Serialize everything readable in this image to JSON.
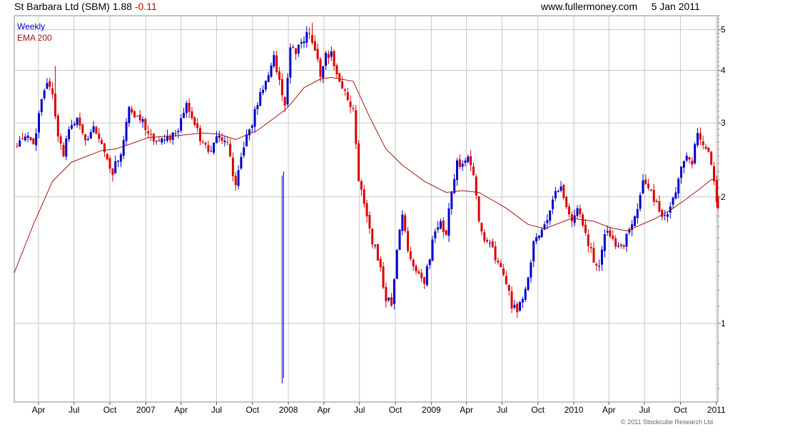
{
  "header": {
    "title": "St Barbara Ltd (SBM) 1.88",
    "change": "-0.11",
    "site": "www.fullermoney.com",
    "date": "5 Jan 2011"
  },
  "legend": {
    "weekly": "Weekly",
    "ema": "EMA 200"
  },
  "copyright": "© 2011 Stockcube Research Ltd",
  "colors": {
    "up": "#0000cc",
    "down": "#dd0000",
    "ema": "#aa1111",
    "grid": "#c8c8c8"
  },
  "chart_data": {
    "type": "candlestick",
    "scale": "log",
    "ylim": [
      0.65,
      5.4
    ],
    "y_ticks": [
      1,
      2,
      3,
      4,
      5
    ],
    "x_range": [
      "2006-01-29",
      "2011-01-05"
    ],
    "x_ticks": [
      {
        "date": "2006-04-01",
        "label": "Apr"
      },
      {
        "date": "2006-07-01",
        "label": "Jul"
      },
      {
        "date": "2006-10-01",
        "label": "Oct"
      },
      {
        "date": "2007-01-01",
        "label": "2007"
      },
      {
        "date": "2007-04-01",
        "label": "Apr"
      },
      {
        "date": "2007-07-01",
        "label": "Jul"
      },
      {
        "date": "2007-10-01",
        "label": "Oct"
      },
      {
        "date": "2008-01-01",
        "label": "2008"
      },
      {
        "date": "2008-04-01",
        "label": "Apr"
      },
      {
        "date": "2008-07-01",
        "label": "Jul"
      },
      {
        "date": "2008-10-01",
        "label": "Oct"
      },
      {
        "date": "2009-01-01",
        "label": "2009"
      },
      {
        "date": "2009-04-01",
        "label": "Apr"
      },
      {
        "date": "2009-07-01",
        "label": "Jul"
      },
      {
        "date": "2009-10-01",
        "label": "Oct"
      },
      {
        "date": "2010-01-01",
        "label": "2010"
      },
      {
        "date": "2010-04-01",
        "label": "Apr"
      },
      {
        "date": "2010-07-01",
        "label": "Jul"
      },
      {
        "date": "2010-10-01",
        "label": "Oct"
      },
      {
        "date": "2011-01-01",
        "label": "2011"
      }
    ],
    "close_path": [
      [
        "2006-02-05",
        2.62
      ],
      [
        "2006-02-26",
        2.78
      ],
      [
        "2006-03-19",
        2.66
      ],
      [
        "2006-04-09",
        3.45
      ],
      [
        "2006-04-23",
        3.65
      ],
      [
        "2006-05-07",
        3.55
      ],
      [
        "2006-05-21",
        2.85
      ],
      [
        "2006-06-04",
        2.55
      ],
      [
        "2006-06-18",
        2.95
      ],
      [
        "2006-07-09",
        3.02
      ],
      [
        "2006-07-30",
        2.7
      ],
      [
        "2006-08-20",
        2.9
      ],
      [
        "2006-09-10",
        2.65
      ],
      [
        "2006-09-24",
        2.45
      ],
      [
        "2006-10-08",
        2.3
      ],
      [
        "2006-10-29",
        2.55
      ],
      [
        "2006-11-19",
        3.25
      ],
      [
        "2006-12-10",
        3.1
      ],
      [
        "2006-12-31",
        2.95
      ],
      [
        "2007-01-21",
        2.65
      ],
      [
        "2007-02-11",
        2.7
      ],
      [
        "2007-03-04",
        2.75
      ],
      [
        "2007-03-25",
        2.9
      ],
      [
        "2007-04-15",
        3.3
      ],
      [
        "2007-05-06",
        2.95
      ],
      [
        "2007-05-27",
        2.65
      ],
      [
        "2007-06-17",
        2.6
      ],
      [
        "2007-07-08",
        2.85
      ],
      [
        "2007-07-29",
        2.65
      ],
      [
        "2007-08-19",
        2.1
      ],
      [
        "2007-09-02",
        2.55
      ],
      [
        "2007-09-23",
        2.9
      ],
      [
        "2007-10-14",
        3.3
      ],
      [
        "2007-11-04",
        3.85
      ],
      [
        "2007-11-25",
        4.25
      ],
      [
        "2007-12-09",
        3.8
      ],
      [
        "2007-12-23",
        3.3
      ],
      [
        "2008-01-06",
        4.6
      ],
      [
        "2008-01-20",
        4.4
      ],
      [
        "2008-02-10",
        4.75
      ],
      [
        "2008-02-24",
        4.95
      ],
      [
        "2008-03-09",
        4.55
      ],
      [
        "2008-03-23",
        3.95
      ],
      [
        "2008-04-06",
        4.3
      ],
      [
        "2008-04-20",
        4.35
      ],
      [
        "2008-05-04",
        3.9
      ],
      [
        "2008-05-18",
        3.55
      ],
      [
        "2008-06-01",
        3.45
      ],
      [
        "2008-06-15",
        3.2
      ],
      [
        "2008-06-29",
        2.2
      ],
      [
        "2008-07-13",
        1.95
      ],
      [
        "2008-07-27",
        1.65
      ],
      [
        "2008-08-10",
        1.5
      ],
      [
        "2008-08-24",
        1.35
      ],
      [
        "2008-09-07",
        1.15
      ],
      [
        "2008-09-21",
        1.1
      ],
      [
        "2008-10-05",
        1.5
      ],
      [
        "2008-10-19",
        1.8
      ],
      [
        "2008-11-02",
        1.5
      ],
      [
        "2008-11-16",
        1.35
      ],
      [
        "2008-11-30",
        1.3
      ],
      [
        "2008-12-14",
        1.25
      ],
      [
        "2008-12-28",
        1.45
      ],
      [
        "2009-01-11",
        1.65
      ],
      [
        "2009-01-25",
        1.72
      ],
      [
        "2009-02-08",
        1.65
      ],
      [
        "2009-02-22",
        2.1
      ],
      [
        "2009-03-08",
        2.4
      ],
      [
        "2009-03-22",
        2.4
      ],
      [
        "2009-04-05",
        2.5
      ],
      [
        "2009-04-19",
        2.3
      ],
      [
        "2009-05-03",
        1.75
      ],
      [
        "2009-05-17",
        1.6
      ],
      [
        "2009-05-31",
        1.55
      ],
      [
        "2009-06-14",
        1.45
      ],
      [
        "2009-06-28",
        1.35
      ],
      [
        "2009-07-12",
        1.25
      ],
      [
        "2009-07-26",
        1.1
      ],
      [
        "2009-08-09",
        1.08
      ],
      [
        "2009-08-23",
        1.15
      ],
      [
        "2009-09-06",
        1.3
      ],
      [
        "2009-09-20",
        1.55
      ],
      [
        "2009-10-04",
        1.65
      ],
      [
        "2009-10-18",
        1.75
      ],
      [
        "2009-11-01",
        1.85
      ],
      [
        "2009-11-15",
        2.05
      ],
      [
        "2009-11-29",
        2.1
      ],
      [
        "2009-12-13",
        1.85
      ],
      [
        "2009-12-27",
        1.75
      ],
      [
        "2010-01-10",
        1.85
      ],
      [
        "2010-01-24",
        1.75
      ],
      [
        "2010-02-07",
        1.55
      ],
      [
        "2010-02-21",
        1.4
      ],
      [
        "2010-03-07",
        1.35
      ],
      [
        "2010-03-21",
        1.65
      ],
      [
        "2010-04-04",
        1.6
      ],
      [
        "2010-04-18",
        1.55
      ],
      [
        "2010-05-02",
        1.5
      ],
      [
        "2010-05-16",
        1.6
      ],
      [
        "2010-05-30",
        1.7
      ],
      [
        "2010-06-13",
        1.85
      ],
      [
        "2010-06-27",
        2.2
      ],
      [
        "2010-07-11",
        2.15
      ],
      [
        "2010-07-25",
        1.95
      ],
      [
        "2010-08-08",
        1.85
      ],
      [
        "2010-08-22",
        1.8
      ],
      [
        "2010-09-05",
        1.9
      ],
      [
        "2010-09-19",
        2.05
      ],
      [
        "2010-10-03",
        2.4
      ],
      [
        "2010-10-17",
        2.55
      ],
      [
        "2010-10-31",
        2.45
      ],
      [
        "2010-11-14",
        2.9
      ],
      [
        "2010-11-28",
        2.7
      ],
      [
        "2010-12-12",
        2.55
      ],
      [
        "2010-12-26",
        2.2
      ],
      [
        "2011-01-05",
        1.88
      ]
    ],
    "ema_path": [
      [
        "2006-01-29",
        1.32
      ],
      [
        "2006-03-19",
        1.72
      ],
      [
        "2006-05-07",
        2.18
      ],
      [
        "2006-06-25",
        2.42
      ],
      [
        "2006-09-10",
        2.58
      ],
      [
        "2006-10-15",
        2.6
      ],
      [
        "2006-11-26",
        2.68
      ],
      [
        "2007-01-07",
        2.77
      ],
      [
        "2007-03-25",
        2.8
      ],
      [
        "2007-05-27",
        2.84
      ],
      [
        "2007-07-08",
        2.82
      ],
      [
        "2007-08-19",
        2.74
      ],
      [
        "2007-10-14",
        2.88
      ],
      [
        "2007-11-25",
        3.08
      ],
      [
        "2007-12-23",
        3.22
      ],
      [
        "2008-01-06",
        3.32
      ],
      [
        "2008-02-10",
        3.64
      ],
      [
        "2008-03-23",
        3.82
      ],
      [
        "2008-04-20",
        3.85
      ],
      [
        "2008-06-15",
        3.77
      ],
      [
        "2008-07-27",
        3.1
      ],
      [
        "2008-09-07",
        2.6
      ],
      [
        "2008-10-19",
        2.38
      ],
      [
        "2008-12-14",
        2.18
      ],
      [
        "2009-02-08",
        2.05
      ],
      [
        "2009-03-22",
        2.07
      ],
      [
        "2009-05-03",
        2.05
      ],
      [
        "2009-07-12",
        1.88
      ],
      [
        "2009-09-06",
        1.72
      ],
      [
        "2009-10-18",
        1.68
      ],
      [
        "2009-12-27",
        1.78
      ],
      [
        "2010-02-21",
        1.75
      ],
      [
        "2010-04-04",
        1.69
      ],
      [
        "2010-05-16",
        1.66
      ],
      [
        "2010-07-25",
        1.77
      ],
      [
        "2010-09-05",
        1.86
      ],
      [
        "2010-10-17",
        1.98
      ],
      [
        "2010-11-28",
        2.12
      ],
      [
        "2010-12-19",
        2.2
      ],
      [
        "2011-01-05",
        2.18
      ]
    ],
    "extremes": [
      {
        "date": "2007-12-16",
        "low": 0.72,
        "high": 2.25
      },
      {
        "date": "2008-03-02",
        "high": 5.2
      },
      {
        "date": "2006-05-14",
        "high": 4.1
      },
      {
        "date": "2008-06-22",
        "low": 2.95
      }
    ]
  }
}
